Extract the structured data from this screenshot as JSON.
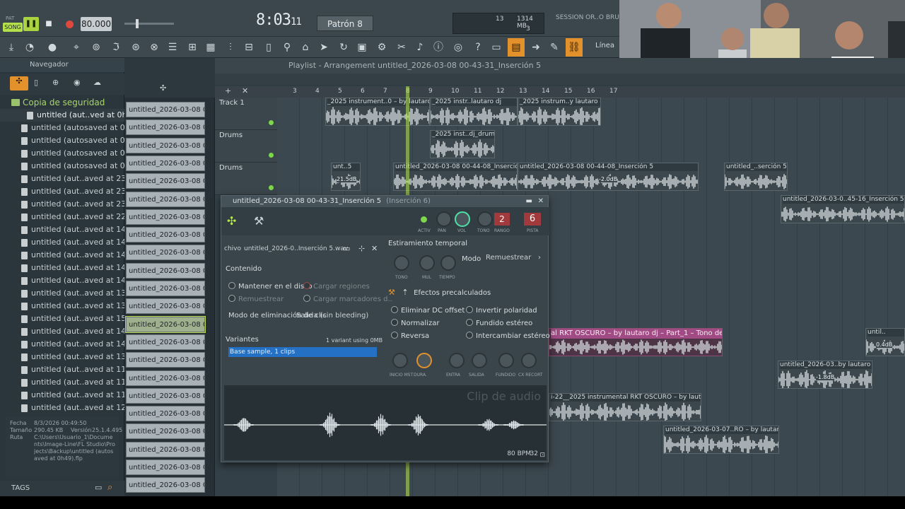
{
  "transport": {
    "pat_label": "PAT",
    "song_label": "SONG",
    "tempo": "80.000",
    "time_main": "8:03",
    "time_sub": "11",
    "pattern": "Patrón 8",
    "cpu_num": "13",
    "ram": "1314 MB",
    "poly": "3",
    "hint": "SESSION OR..O BRU"
  },
  "toolbar": {
    "line_mode": "Línea"
  },
  "browser": {
    "title": "Navegador",
    "folder": "Copia de seguridad",
    "files": [
      "untitled (aut..ved at 0h49)",
      "untitled (autosaved at 0h39)",
      "untitled (autosaved at 0h28)",
      "untitled (autosaved at 0h17)",
      "untitled (autosaved at 0h07)",
      "untitled (aut..aved at 23h56)",
      "untitled (aut..aved at 23h45)",
      "untitled (aut..aved at 23h35)",
      "untitled (aut..aved at 22h42)",
      "untitled (aut..aved at 14h24)",
      "untitled (aut..aved at 14h59)",
      "untitled (aut..aved at 14h47)",
      "untitled (aut..aved at 14h37)",
      "untitled (aut..aved at 14h27)",
      "untitled (aut..aved at 13h59)",
      "untitled (aut..aved at 13h49)",
      "untitled (aut..aved at 15h11)",
      "untitled (aut..aved at 14h43)",
      "untitled (aut..aved at 14h31)",
      "untitled (aut..aved at 13h42)",
      "untitled (aut..aved at 11h56)",
      "untitled (aut..aved at 11h41)",
      "untitled (aut..aved at 11h21)",
      "untitled (aut..aved at 12h11)"
    ],
    "info": {
      "fecha_label": "Fecha",
      "fecha": "8/3/2026 00:49:50",
      "tamano_label": "Tamaño",
      "tamano": "290.45 KB",
      "version_label": "Versión",
      "version": "25.1.4.495",
      "ruta_label": "Ruta",
      "ruta": "C:\\Users\\Usuario_1\\Documents\\Image-Line\\FL Studio\\Projects\\Backup\\untitled (autosaved at 0h49).flp"
    },
    "tags": "TAGS"
  },
  "picker": {
    "item_label": "untitled_2026-03-08 00-...",
    "count": 22,
    "selected_index": 12
  },
  "playlist": {
    "title": "Playlist - Arrangement",
    "project": "untitled_2026-03-08 00-43-31_Inserción 5",
    "ruler": [
      "3",
      "4",
      "5",
      "6",
      "7",
      "8",
      "9",
      "10",
      "11",
      "12",
      "13",
      "14",
      "15",
      "16",
      "17"
    ],
    "tracks": [
      {
        "name": "Track 1"
      },
      {
        "name": "Drums"
      },
      {
        "name": "Drums"
      }
    ],
    "clips": {
      "c1": "_2025 instrument..0 – by lautaro dj",
      "c2": "_2025 instr..lautaro dj",
      "c3": "_2025 instrum..y lautaro dj",
      "c4": "_2025 inst..dj_drums",
      "c5": "unt..5",
      "c5_db": "21.5dB",
      "c6": "untitled_2026-03-08 00-44-08_Inserción 5",
      "c7": "untitled_2026-03-08 00-44-08_Inserción 5",
      "c7_db": "-2.0dB",
      "c8": "untitled_..serción 5",
      "c9": "untitled_2026-03-0..45-16_Inserción 5",
      "c10": "al RKT OSCURO – by lautaro dj – Part_1 – Tono del canal",
      "c11": "until..",
      "c11_db": "0.4dB",
      "c12": "untitled_2026-03..by lautaro dj",
      "c12_db": "-1.8dB",
      "c13": "i-22__2025 instrumental RKT OSCURO – by lautaro dj",
      "c14": "untitled_2026-03-07..RO – by lautaro dj"
    }
  },
  "channel": {
    "title": "untitled_2026-03-08 00-43-31_Inserción 5",
    "subtitle": "(Inserción 6)",
    "knobs": [
      "ACTIV",
      "PAN",
      "VOL",
      "TONO",
      "RANGO",
      "PISTA"
    ],
    "range_value": "2",
    "track_value": "6",
    "file_label": "chivo",
    "file_name": "untitled_2026-0..Inserción 5.wav",
    "content_title": "Contenido",
    "keep_on_disk": "Mantener en el disco",
    "load_regions": "Cargar regiones",
    "resample": "Remuestrear",
    "load_markers": "Cargar marcadores d..",
    "declick_label": "Modo de eliminación de clic",
    "declick_value": "Salida (sin bleeding)",
    "variants_title": "Variantes",
    "variants_info": "1 variant using 0MB",
    "variant_item": "Base sample, 1 clips",
    "stretch_title": "Estiramiento temporal",
    "stretch_knobs": [
      "TONO",
      "MUL",
      "TIEMPO"
    ],
    "mode_label": "Modo",
    "mode_value": "Remuestrear",
    "precomp_title": "Efectos precalculados",
    "fx_left": [
      "Eliminar DC offset",
      "Normalizar",
      "Reversa"
    ],
    "fx_right": [
      "Invertir polaridad",
      "Fundido estéreo",
      "Intercambiar estéreo"
    ],
    "bottom_knobs": [
      "INICIO MST",
      "DURA.",
      "ENTRA",
      "SALIDA",
      "FUNDIDO",
      "CX RECORT"
    ],
    "wave_label": "Clip de audio",
    "bpm": "80 BPM",
    "steps": "32"
  }
}
